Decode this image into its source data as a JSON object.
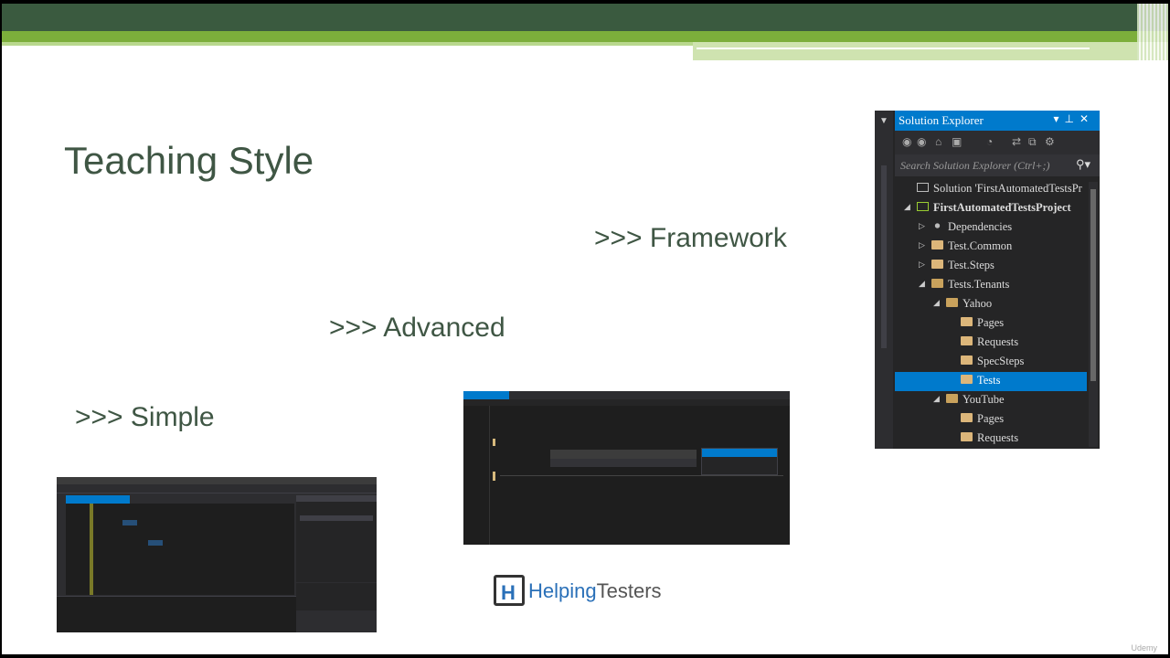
{
  "slide": {
    "title": "Teaching Style",
    "bullets": {
      "framework": ">>> Framework",
      "advanced": ">>> Advanced",
      "simple": ">>> Simple"
    }
  },
  "solution_explorer": {
    "title": "Solution Explorer",
    "search_placeholder": "Search Solution Explorer (Ctrl+;)",
    "items": [
      {
        "label": "Solution 'FirstAutomatedTestsPr",
        "indent": 0,
        "arrow": "",
        "icon": "solution-icon",
        "selected": false
      },
      {
        "label": "FirstAutomatedTestsProject",
        "indent": 0,
        "arrow": "◢",
        "icon": "project-icon",
        "selected": false
      },
      {
        "label": "Dependencies",
        "indent": 1,
        "arrow": "▷",
        "icon": "dependencies-icon",
        "selected": false
      },
      {
        "label": "Test.Common",
        "indent": 1,
        "arrow": "▷",
        "icon": "folder-icon",
        "selected": false
      },
      {
        "label": "Test.Steps",
        "indent": 1,
        "arrow": "▷",
        "icon": "folder-icon",
        "selected": false
      },
      {
        "label": "Tests.Tenants",
        "indent": 1,
        "arrow": "◢",
        "icon": "folder-open-icon",
        "selected": false
      },
      {
        "label": "Yahoo",
        "indent": 2,
        "arrow": "◢",
        "icon": "folder-open-icon",
        "selected": false
      },
      {
        "label": "Pages",
        "indent": 3,
        "arrow": "",
        "icon": "folder-icon",
        "selected": false
      },
      {
        "label": "Requests",
        "indent": 3,
        "arrow": "",
        "icon": "folder-icon",
        "selected": false
      },
      {
        "label": "SpecSteps",
        "indent": 3,
        "arrow": "",
        "icon": "folder-icon",
        "selected": false
      },
      {
        "label": "Tests",
        "indent": 3,
        "arrow": "",
        "icon": "folder-icon",
        "selected": true
      },
      {
        "label": "YouTube",
        "indent": 2,
        "arrow": "◢",
        "icon": "folder-open-icon",
        "selected": false
      },
      {
        "label": "Pages",
        "indent": 3,
        "arrow": "",
        "icon": "folder-icon",
        "selected": false
      },
      {
        "label": "Requests",
        "indent": 3,
        "arrow": "",
        "icon": "folder-icon",
        "selected": false
      }
    ]
  },
  "logo": {
    "prefix": "Helping",
    "suffix": "Testers"
  },
  "colors": {
    "title_text": "#3f5644",
    "band_dark": "#3a5a3f",
    "band_green": "#7cae3b",
    "vs_blue": "#007acc",
    "vs_background": "#252526"
  },
  "watermark": "Udemy"
}
